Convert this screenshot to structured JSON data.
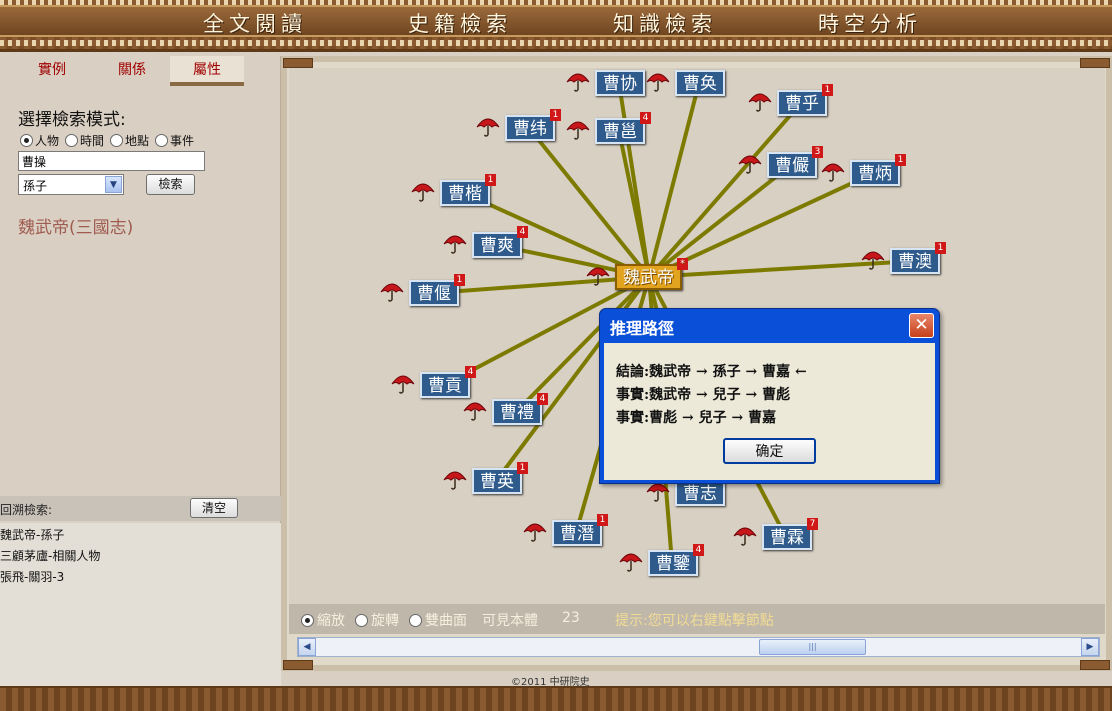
{
  "nav": {
    "items": [
      "全文閱讀",
      "史籍檢索",
      "知識檢索",
      "時空分析"
    ]
  },
  "left": {
    "tabs": [
      "實例",
      "關係",
      "屬性"
    ],
    "mode_title": "選擇檢索模式:",
    "modes": [
      "人物",
      "時間",
      "地點",
      "事件"
    ],
    "selected_mode": "人物",
    "search_value": "曹操",
    "relation_select": "孫子",
    "search_button": "檢索",
    "result": "魏武帝(三國志)",
    "history_label": "回溯檢索:",
    "clear_button": "清空",
    "history": [
      "魏武帝-孫子",
      "三顧茅廬-相關人物",
      "張飛-關羽-3"
    ]
  },
  "graph": {
    "center": {
      "label": "魏武帝",
      "badge": "*"
    },
    "nodes": [
      {
        "label": "曹协",
        "badge": ""
      },
      {
        "label": "曹奂",
        "badge": ""
      },
      {
        "label": "曹乎",
        "badge": "1"
      },
      {
        "label": "曹纬",
        "badge": "1"
      },
      {
        "label": "曹邕",
        "badge": "4"
      },
      {
        "label": "曹儼",
        "badge": "3"
      },
      {
        "label": "曹楷",
        "badge": "1"
      },
      {
        "label": "曹炳",
        "badge": "1"
      },
      {
        "label": "曹爽",
        "badge": "4"
      },
      {
        "label": "曹澳",
        "badge": "1"
      },
      {
        "label": "曹偃",
        "badge": "1"
      },
      {
        "label": "曹貢",
        "badge": "4"
      },
      {
        "label": "曹禮",
        "badge": "4"
      },
      {
        "label": "曹英",
        "badge": "1"
      },
      {
        "label": "曹志",
        "badge": ""
      },
      {
        "label": "曹潛",
        "badge": "1"
      },
      {
        "label": "曹霖",
        "badge": "7"
      },
      {
        "label": "曹鑒",
        "badge": "4"
      }
    ],
    "colors": {
      "node": "#2f5b8c",
      "center": "#e2a41f",
      "edge": "#7d7a00",
      "badge": "#d01818"
    }
  },
  "dialog": {
    "title": "推理路徑",
    "lines": [
      "結論:魏武帝 → 孫子 → 曹嘉 ←",
      "事實:魏武帝 → 兒子 → 曹彪",
      "事實:曹彪 → 兒子 → 曹嘉"
    ],
    "ok_button": "确定"
  },
  "controls": {
    "modes": [
      "縮放",
      "旋轉",
      "雙曲面"
    ],
    "selected": "縮放",
    "visible_label": "可見本體",
    "visible_count": "23",
    "hint": "提示:您可以右鍵點擊節點"
  },
  "footer": {
    "copyright": "©2011 中研院史"
  }
}
